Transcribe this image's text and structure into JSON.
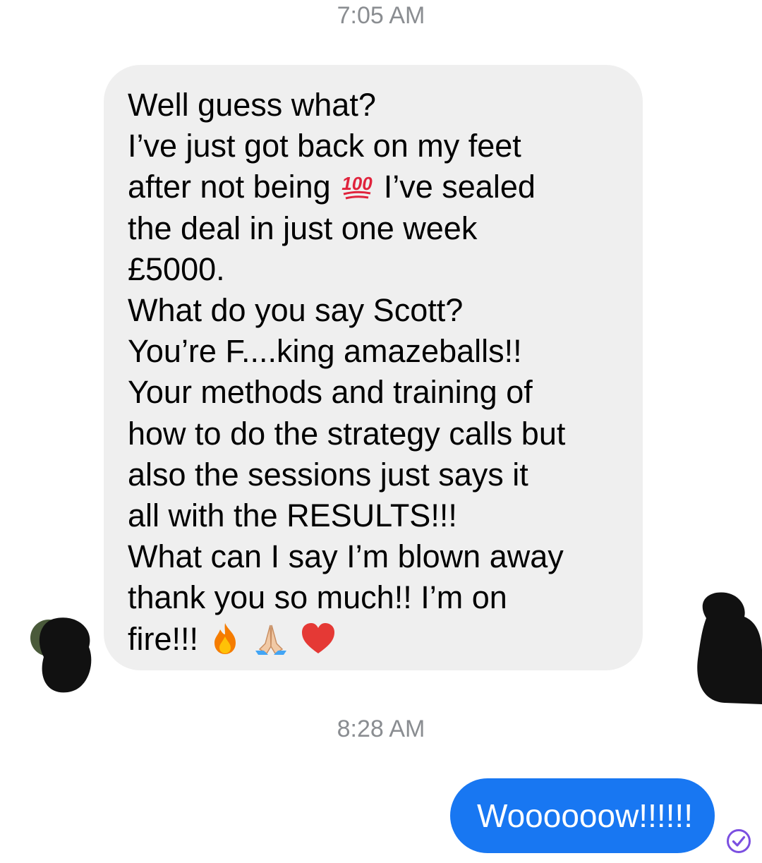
{
  "conversation": {
    "timestamps": [
      "7:05 AM",
      "8:28 AM"
    ],
    "incoming_message": {
      "lines": [
        "Well guess what?",
        "I’ve just got back on my feet",
        "after not being",
        "I’ve sealed",
        "the deal in just one week",
        "£5000.",
        "What do you say Scott?",
        "You’re F....king amazeballs!!",
        "Your methods and training of",
        "how to do the strategy calls but",
        "also the sessions just says it",
        "all with the RESULTS!!!",
        "What can I say I’m blown away",
        "thank you so much!! I’m on",
        "fire!!!"
      ],
      "emojis": [
        "hundred-points-emoji",
        "fire-emoji",
        "folded-hands-emoji",
        "red-heart-emoji"
      ],
      "bubble_color": "#efefef"
    },
    "outgoing_message": {
      "text": "Woooooow!!!!!!",
      "bubble_color": "#1877f2",
      "status_icon": "seen-check-icon"
    },
    "colors": {
      "timestamp": "#8a8d91",
      "redaction": "#111111",
      "status": "#7b4fe0"
    }
  }
}
